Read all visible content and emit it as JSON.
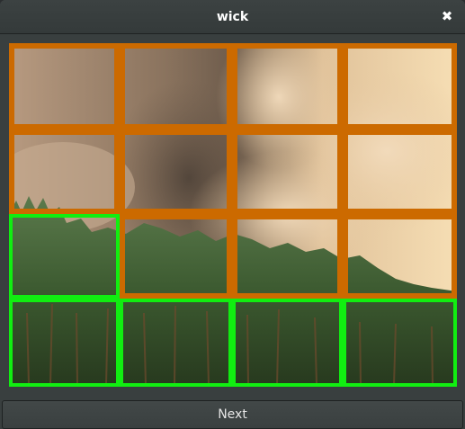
{
  "window": {
    "title": "wick",
    "close_glyph": "✖",
    "close_icon": "close-icon"
  },
  "grid": {
    "rows": 4,
    "cols": 4,
    "tile_states": [
      [
        "unselected",
        "unselected",
        "unselected",
        "unselected"
      ],
      [
        "unselected",
        "unselected",
        "unselected",
        "unselected"
      ],
      [
        "selected",
        "unselected",
        "unselected",
        "unselected"
      ],
      [
        "selected",
        "selected",
        "selected",
        "selected"
      ]
    ],
    "colors": {
      "unselected": "#cc6a00",
      "selected": "#11ee11"
    }
  },
  "footer": {
    "next_label": "Next"
  }
}
